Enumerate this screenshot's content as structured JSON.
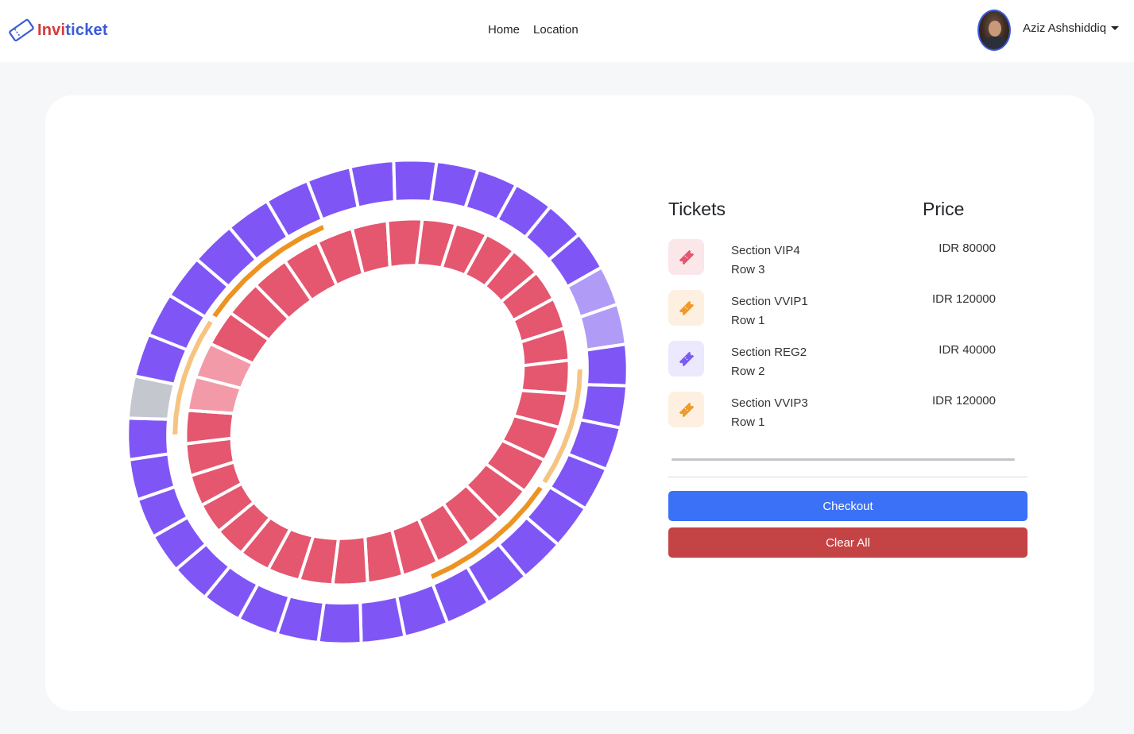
{
  "brand": {
    "part1": "Invi",
    "part2": "ticket"
  },
  "nav": {
    "home": "Home",
    "location": "Location"
  },
  "user": {
    "name": "Aziz Ashshiddiq"
  },
  "tickets": {
    "header_tickets": "Tickets",
    "header_price": "Price",
    "items": [
      {
        "section": "Section VIP4",
        "row": "Row 3",
        "price": "IDR 80000",
        "color": "#e5566f",
        "bg": "#fbe6ea"
      },
      {
        "section": "Section VVIP1",
        "row": "Row 1",
        "price": "IDR 120000",
        "color": "#ef9a2c",
        "bg": "#fdf0e0"
      },
      {
        "section": "Section REG2",
        "row": "Row 2",
        "price": "IDR 40000",
        "color": "#7a5cf2",
        "bg": "#ece8fd"
      },
      {
        "section": "Section VVIP3",
        "row": "Row 1",
        "price": "IDR 120000",
        "color": "#ef9a2c",
        "bg": "#fdf0e0"
      }
    ]
  },
  "actions": {
    "checkout": "Checkout",
    "clear": "Clear All"
  },
  "colors": {
    "regular": "#7f56f5",
    "regular_selected": "#b09cf7",
    "unavailable": "#c5c7cf",
    "vip": "#e5566f",
    "vip_selected": "#f29aa8",
    "vvip_light": "#f6c482",
    "vvip": "#ec9321"
  }
}
